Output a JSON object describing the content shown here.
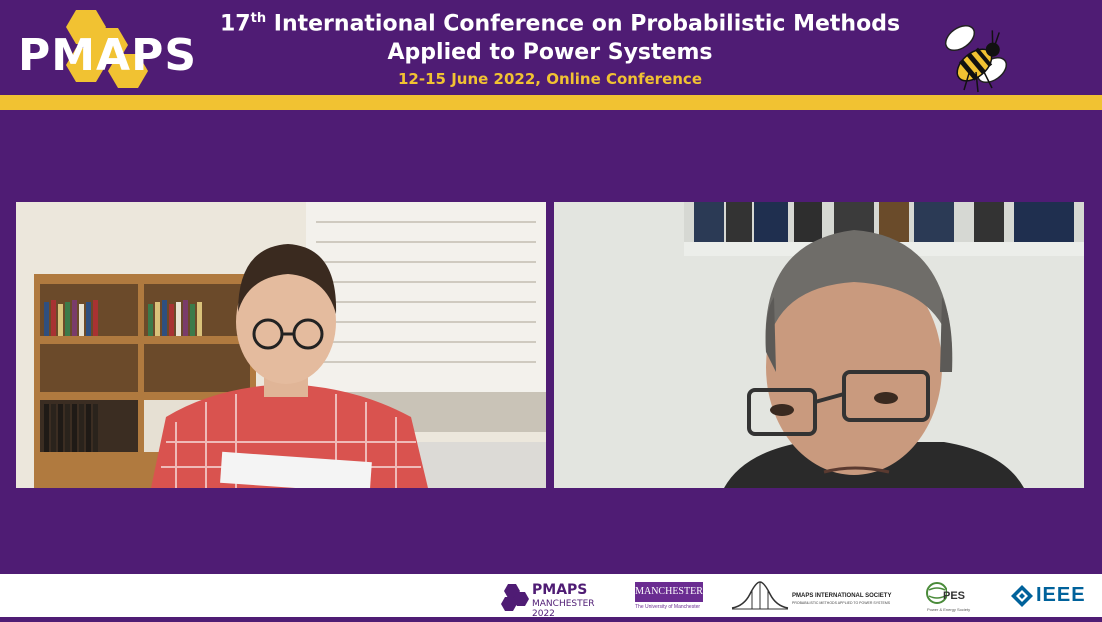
{
  "header": {
    "logo_text": "PMAPS",
    "title_number": "17",
    "title_ordinal": "th",
    "title_line1_rest": " International Conference on Probabilistic Methods",
    "title_line2": "Applied to Power Systems",
    "subtitle": "12-15 June 2022, Online Conference"
  },
  "colors": {
    "background": "#4f1c74",
    "accent": "#f1c232",
    "text": "#ffffff"
  },
  "videos": [
    {
      "id": "participant-left",
      "label": ""
    },
    {
      "id": "participant-right",
      "label": ""
    }
  ],
  "sponsors": {
    "pmaps_name": "PMAPS",
    "pmaps_sub": "MANCHESTER 2022",
    "manchester_name": "MANCHESTER",
    "manchester_year": "1824",
    "manchester_sub": "The University of Manchester",
    "society_name": "PMAPS INTERNATIONAL SOCIETY",
    "society_sub": "PROBABILISTIC METHODS APPLIED TO POWER SYSTEMS",
    "pes_name": "PES",
    "pes_sub": "Power & Energy Society",
    "ieee_name": "IEEE"
  },
  "icons": [
    "hexagon-logo-icon",
    "bee-icon",
    "ieee-diamond-icon",
    "pes-globe-icon"
  ]
}
